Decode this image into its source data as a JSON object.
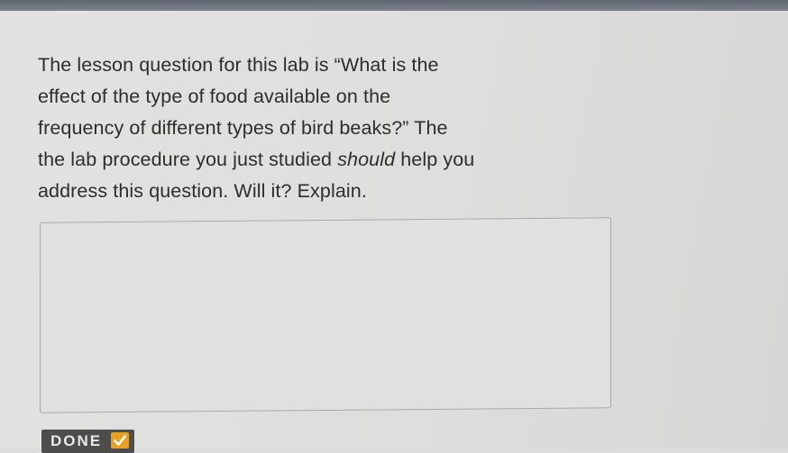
{
  "question": {
    "line1": "The lesson question for this lab is “What is the",
    "line2": "effect of the type of food available on the",
    "line3": "frequency of different types of bird beaks?” The",
    "line4_before": "the lab procedure you just studied ",
    "line4_emphasis": "should",
    "line4_after": " help you",
    "line5": "address this question. Will it? Explain."
  },
  "answer": {
    "value": "",
    "placeholder": ""
  },
  "done_button": {
    "label": "DONE",
    "icon": "check-icon",
    "icon_color": "#e8a020"
  }
}
